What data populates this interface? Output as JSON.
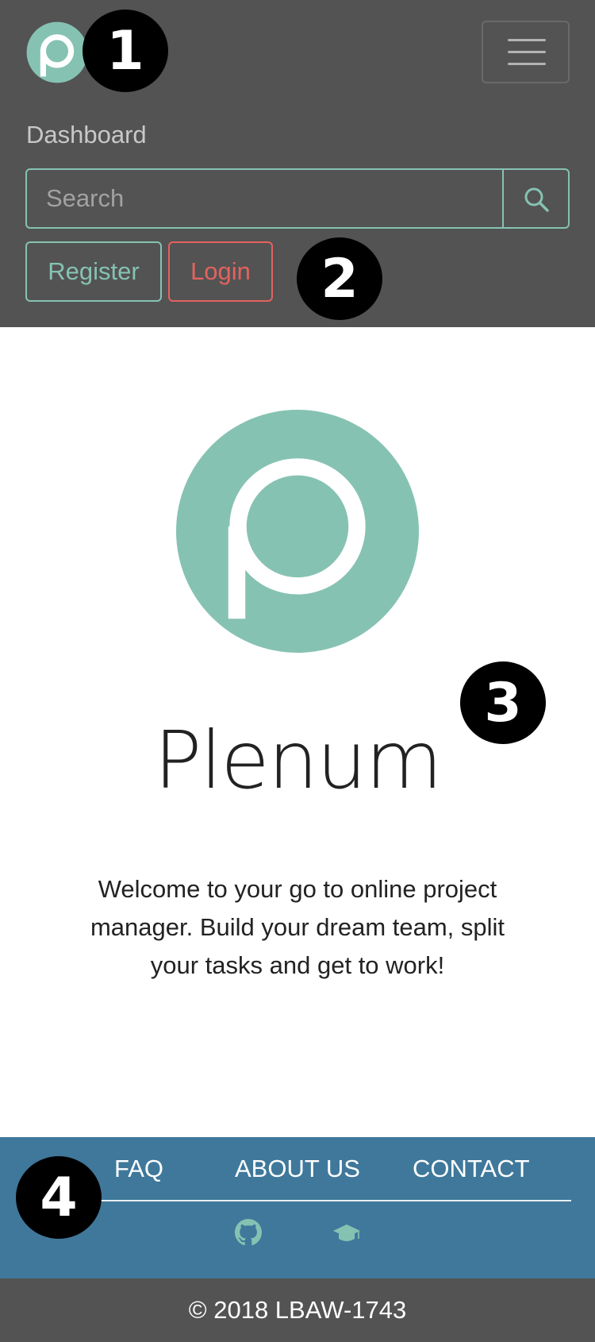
{
  "navbar": {
    "dashboard_label": "Dashboard",
    "search_placeholder": "Search",
    "register_label": "Register",
    "login_label": "Login"
  },
  "markers": [
    "1",
    "2",
    "3",
    "4"
  ],
  "main": {
    "app_name": "Plenum",
    "welcome_text": "Welcome to your go to online project manager. Build your dream team, split your tasks and get to work!"
  },
  "footer": {
    "links": [
      "FAQ",
      "ABOUT US",
      "CONTACT"
    ],
    "icons": [
      "github-icon",
      "graduation-cap-icon"
    ],
    "copyright": "© 2018 LBAW-1743"
  },
  "colors": {
    "navbar_bg": "#535353",
    "accent_teal": "#86c2b2",
    "login_red": "#e4625f",
    "footer_blue": "#3f789b"
  }
}
